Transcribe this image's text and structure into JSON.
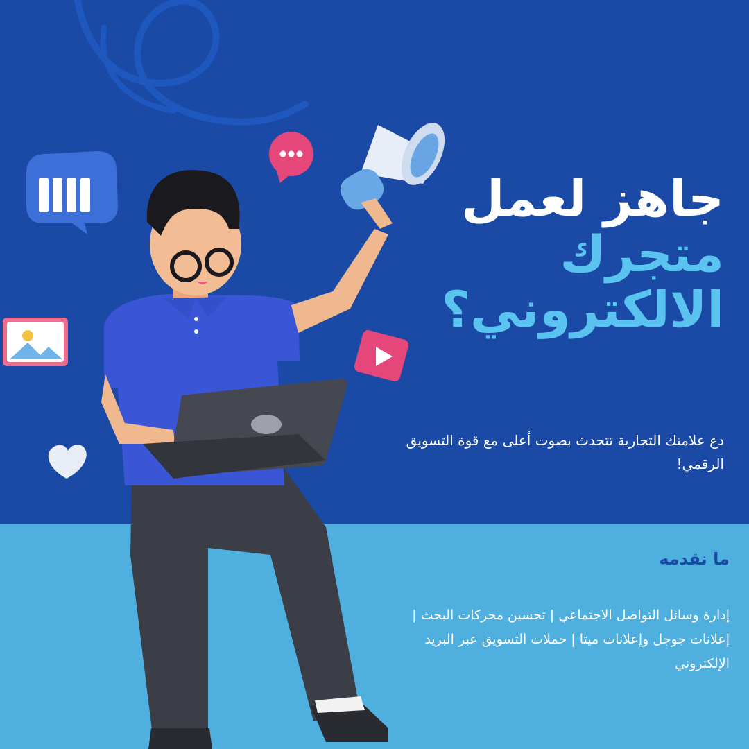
{
  "colors": {
    "top_background": "#1b4aa6",
    "bottom_background": "#4fb0e0",
    "headline_primary": "#ffffff",
    "headline_accent": "#5bc3ef",
    "section_title": "#1b4aa6"
  },
  "icons": [
    "chat-bubble-bars-icon",
    "speech-bubble-dots-icon",
    "megaphone-icon",
    "image-card-icon",
    "play-button-icon",
    "heart-icon",
    "laptop-icon"
  ],
  "headline": {
    "line1": "جاهز لعمل",
    "line2": "متجرك",
    "line3": "الالكتروني؟"
  },
  "tagline": "دع علامتك التجارية تتحدث بصوت أعلى مع قوة التسويق الرقمي!",
  "services_section": {
    "title": "ما نقدمه",
    "description": "إدارة وسائل التواصل الاجتماعي | تحسين محركات البحث | إعلانات جوجل وإعلانات ميتا | حملات التسويق عبر البريد الإلكتروني"
  }
}
